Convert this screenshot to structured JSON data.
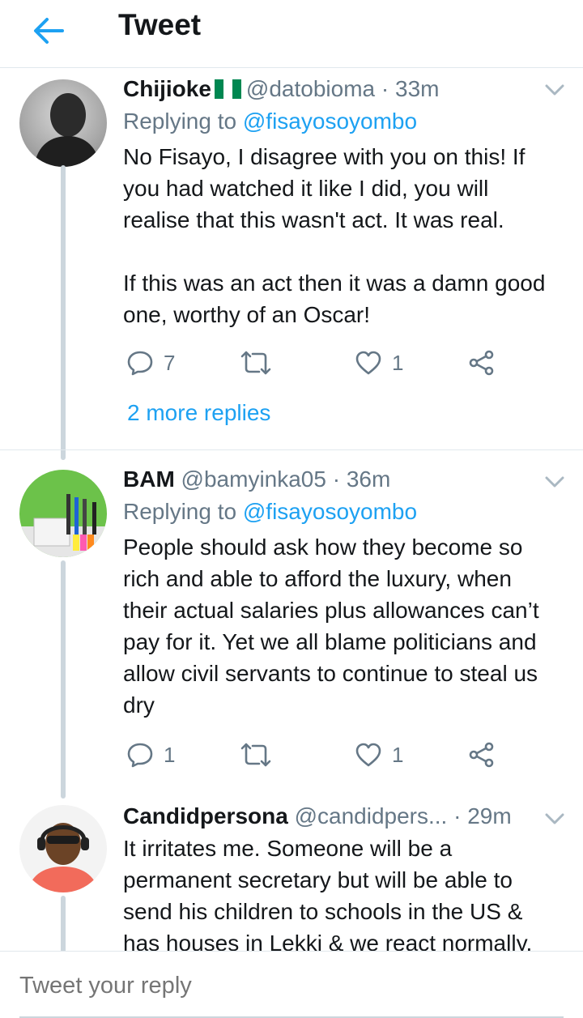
{
  "header": {
    "title": "Tweet"
  },
  "tweets": [
    {
      "name": "Chijioke",
      "handle": "@datobioma",
      "separator": " · ",
      "time": "33m",
      "replying_prefix": "Replying to ",
      "replying_to": "@fisayosoyombo",
      "text": "No Fisayo, I disagree with you on this! If you had watched it like I did, you will realise that this wasn't act. It was real.\n\nIf this was an act then it was a damn good one, worthy of an Oscar!",
      "replies": "7",
      "likes": "1",
      "more_replies": "2 more replies"
    },
    {
      "name": "BAM",
      "handle": "@bamyinka05",
      "separator": " · ",
      "time": "36m",
      "replying_prefix": "Replying to ",
      "replying_to": "@fisayosoyombo",
      "text": "People should ask how they become so rich and able to afford the luxury, when their actual salaries plus allowances can’t pay for it. Yet we all blame politicians and allow civil servants to continue to steal us dry",
      "replies": "1",
      "likes": "1"
    },
    {
      "name": "Candidpersona",
      "handle": "@candidpers...",
      "separator": " · ",
      "time": "29m",
      "text": "It irritates me. Someone will be a permanent secretary but will be able to send his children to schools in the US & has houses in Lekki & we react normally."
    }
  ],
  "reply_bar": {
    "placeholder": "Tweet your reply"
  },
  "colors": {
    "accent": "#1da1f2",
    "secondary": "#657786",
    "thread_line": "#ccd6dd"
  }
}
